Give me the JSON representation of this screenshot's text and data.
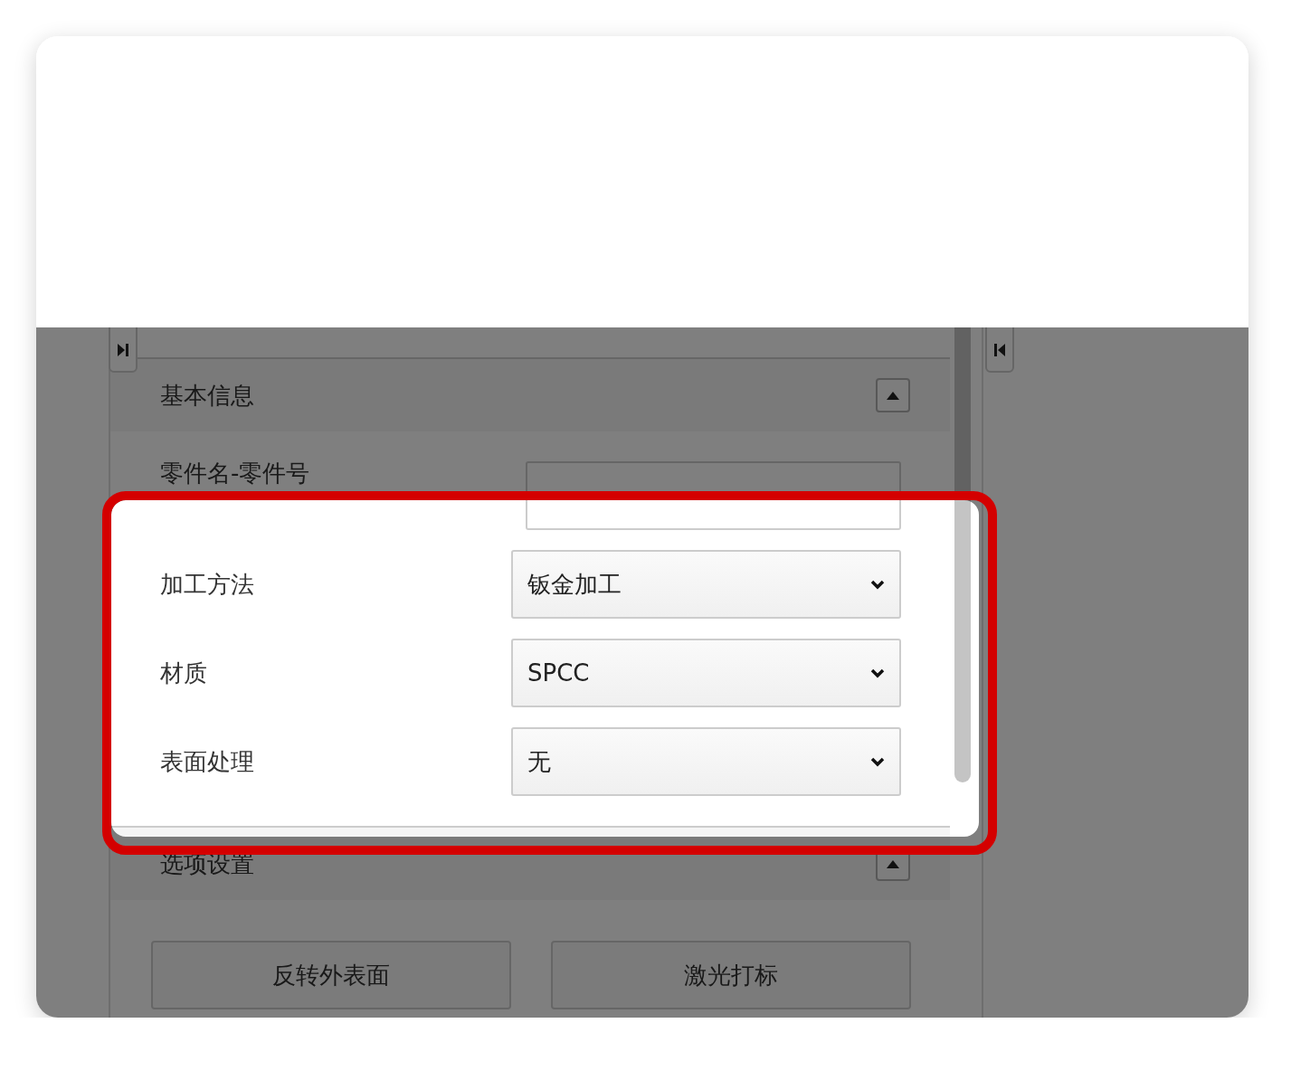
{
  "sections": [
    {
      "title": "基本信息",
      "expanded": true,
      "fields": [
        {
          "label": "零件名-零件号",
          "kind": "text"
        },
        {
          "label": "加工方法",
          "kind": "select",
          "value": "钣金加工"
        },
        {
          "label": "材质",
          "kind": "select",
          "value": "SPCC"
        },
        {
          "label": "表面处理",
          "kind": "select",
          "value": "无"
        }
      ]
    },
    {
      "title": "选项设置",
      "expanded": true,
      "buttons": [
        "反转外表面",
        "激光打标"
      ]
    }
  ]
}
